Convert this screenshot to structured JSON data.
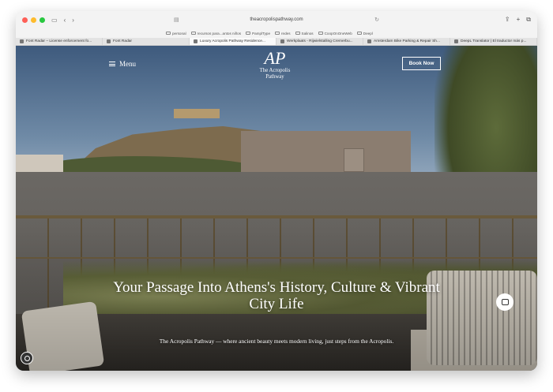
{
  "browser": {
    "url": "theacropolispathway.com",
    "bookmarks": [
      "personal",
      "recursos para...antos niños",
      "PamplType",
      "redes",
      "Salinos",
      "CoopOnOneWeb",
      "Deepl"
    ],
    "tabs": [
      {
        "label": "Font Radar – License enforcement fo..."
      },
      {
        "label": "Font Radar"
      },
      {
        "label": "Luxury Acropolis Pathway Residence...",
        "active": true
      },
      {
        "label": "Werkplaats - Rijwielstalling Cremerbu..."
      },
      {
        "label": "Amsterdam Bike Parking & Repair Sh..."
      },
      {
        "label": "DeepL Translator | El traductor más p..."
      }
    ]
  },
  "site": {
    "menu_label": "Menu",
    "logo_mark": "AP",
    "logo_name_1": "The Acropolis",
    "logo_name_2": "Pathway",
    "book_label": "Book Now",
    "hero_title": "Your Passage Into Athens's History, Culture & Vibrant City Life",
    "hero_subtitle": "The Acropolis Pathway — where ancient beauty meets modern living, just steps from the Acropolis."
  },
  "icons": {
    "menu": "hamburger-icon",
    "chat": "chat-icon",
    "accessibility": "accessibility-icon"
  },
  "colors": {
    "traffic_red": "#fe5f57",
    "traffic_yellow": "#febc2e",
    "traffic_green": "#28c840"
  }
}
